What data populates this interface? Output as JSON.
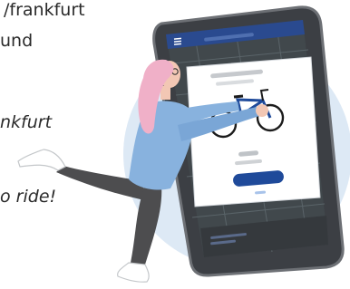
{
  "text": {
    "line1": "/frankfurt",
    "line2": "und",
    "line3": "nkfurt",
    "line4": "o ride!"
  },
  "colors": {
    "circle": "#dde9f5",
    "phone_body": "#3c3f44",
    "phone_frame": "#6d7075",
    "map": "#41484c",
    "app_header": "#2a4a8f",
    "card": "#ffffff",
    "button": "#1f4a9a",
    "hair": "#f0b0c8",
    "jacket": "#88b2de",
    "pants": "#4d4d4f",
    "bike_frame": "#1f4a9a"
  }
}
